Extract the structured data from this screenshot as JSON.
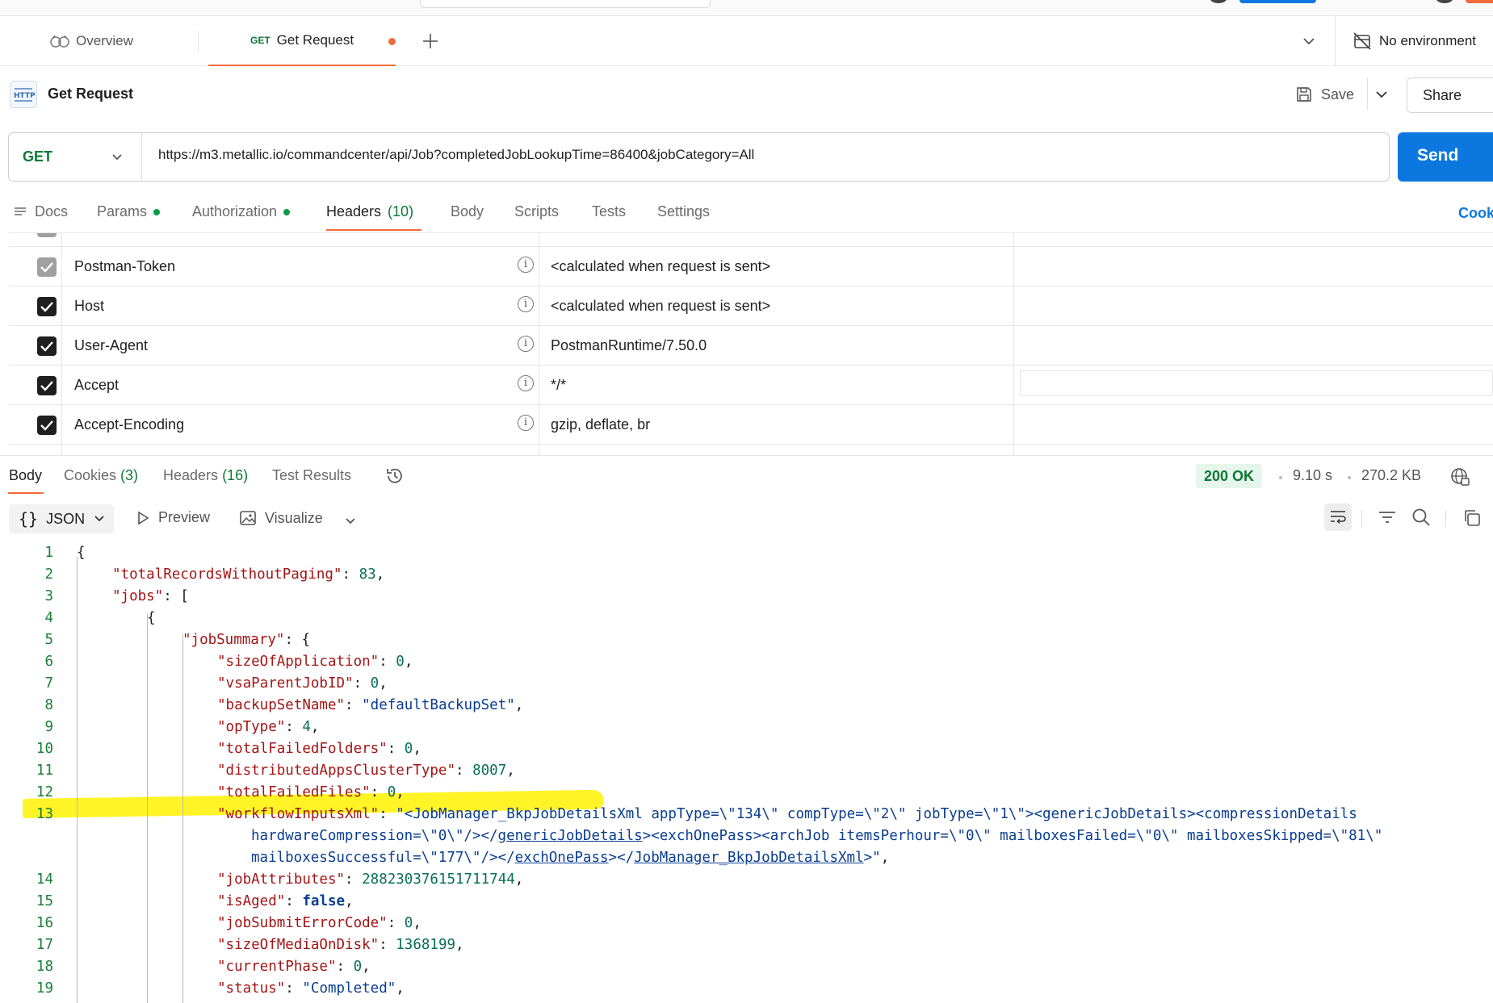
{
  "tabs": {
    "overview_label": "Overview",
    "active_method": "GET",
    "active_label": "Get Request"
  },
  "environment": {
    "label": "No environment"
  },
  "request": {
    "title": "Get Request",
    "save_label": "Save",
    "share_label": "Share",
    "method": "GET",
    "url": "https://m3.metallic.io/commandcenter/api/Job?completedJobLookupTime=86400&jobCategory=All",
    "send_label": "Send"
  },
  "request_tabs": {
    "docs": "Docs",
    "params": "Params",
    "authorization": "Authorization",
    "headers": "Headers",
    "headers_count": "(10)",
    "body": "Body",
    "scripts": "Scripts",
    "tests": "Tests",
    "settings": "Settings",
    "cookies": "Cook"
  },
  "header_rows": [
    {
      "key": "Postman-Token",
      "value": "<calculated when request is sent>",
      "checked": true,
      "locked": true
    },
    {
      "key": "Host",
      "value": "<calculated when request is sent>",
      "checked": true,
      "locked": false
    },
    {
      "key": "User-Agent",
      "value": "PostmanRuntime/7.50.0",
      "checked": true,
      "locked": false
    },
    {
      "key": "Accept",
      "value": "*/*",
      "checked": true,
      "locked": false
    },
    {
      "key": "Accept-Encoding",
      "value": "gzip, deflate, br",
      "checked": true,
      "locked": false
    }
  ],
  "response_tabs": {
    "body": "Body",
    "cookies": "Cookies",
    "cookies_count": "(3)",
    "headers": "Headers",
    "headers_count": "(16)",
    "test_results": "Test Results"
  },
  "response_meta": {
    "status": "200 OK",
    "time": "9.10 s",
    "size": "270.2 KB"
  },
  "response_toolbar": {
    "format": "JSON",
    "preview": "Preview",
    "visualize": "Visualize"
  },
  "code_lines": [
    "1",
    "2",
    "3",
    "4",
    "5",
    "6",
    "7",
    "8",
    "9",
    "10",
    "11",
    "12",
    "13",
    "14",
    "15",
    "16",
    "17",
    "18",
    "19"
  ],
  "code": {
    "l1": "{",
    "l2_key": "\"totalRecordsWithoutPaging\"",
    "l2_val": "83",
    "l3_key": "\"jobs\"",
    "l3_rest": ": [",
    "l4": "{",
    "l5_key": "\"jobSummary\"",
    "l5_rest": ": {",
    "l6_key": "\"sizeOfApplication\"",
    "l6_val": "0",
    "l7_key": "\"vsaParentJobID\"",
    "l7_val": "0",
    "l8_key": "\"backupSetName\"",
    "l8_val": "\"defaultBackupSet\"",
    "l9_key": "\"opType\"",
    "l9_val": "4",
    "l10_key": "\"totalFailedFolders\"",
    "l10_val": "0",
    "l11_key": "\"distributedAppsClusterType\"",
    "l11_val": "8007",
    "l12_key": "\"totalFailedFiles\"",
    "l12_val": "0",
    "l13_key": "\"workflowInputsXml\"",
    "l13_val_a": "\"<JobManager_BkpJobDetailsXml appType=\\\"134\\\" compType=\\\"2\\\" jobType=\\\"1\\\"><genericJobDetails><compressionDetails",
    "l13_val_b1": "hardwareCompression=\\\"0\\\"/></",
    "l13_val_b2": "genericJobDetails",
    "l13_val_b3": "><exchOnePass><archJob itemsPerhour=\\\"0\\\" mailboxesFailed=\\\"0\\\" mailboxesSkipped=\\\"81\\\"",
    "l13_val_c1": "mailboxesSuccessful=\\\"177\\\"/></",
    "l13_val_c2": "exchOnePass",
    "l13_val_c3": "></",
    "l13_val_c4": "JobManager_BkpJobDetailsXml",
    "l13_val_c5": ">\"",
    "l14_key": "\"jobAttributes\"",
    "l14_val": "288230376151711744",
    "l15_key": "\"isAged\"",
    "l15_val": "false",
    "l16_key": "\"jobSubmitErrorCode\"",
    "l16_val": "0",
    "l17_key": "\"sizeOfMediaOnDisk\"",
    "l17_val": "1368199",
    "l18_key": "\"currentPhase\"",
    "l18_val": "0",
    "l19_key": "\"status\"",
    "l19_val": "\"Completed\""
  },
  "colors": {
    "accent_orange": "#f26b3a",
    "send_blue": "#0c78df",
    "method_green": "#0b7a36",
    "highlight_yellow": "#fff200"
  }
}
